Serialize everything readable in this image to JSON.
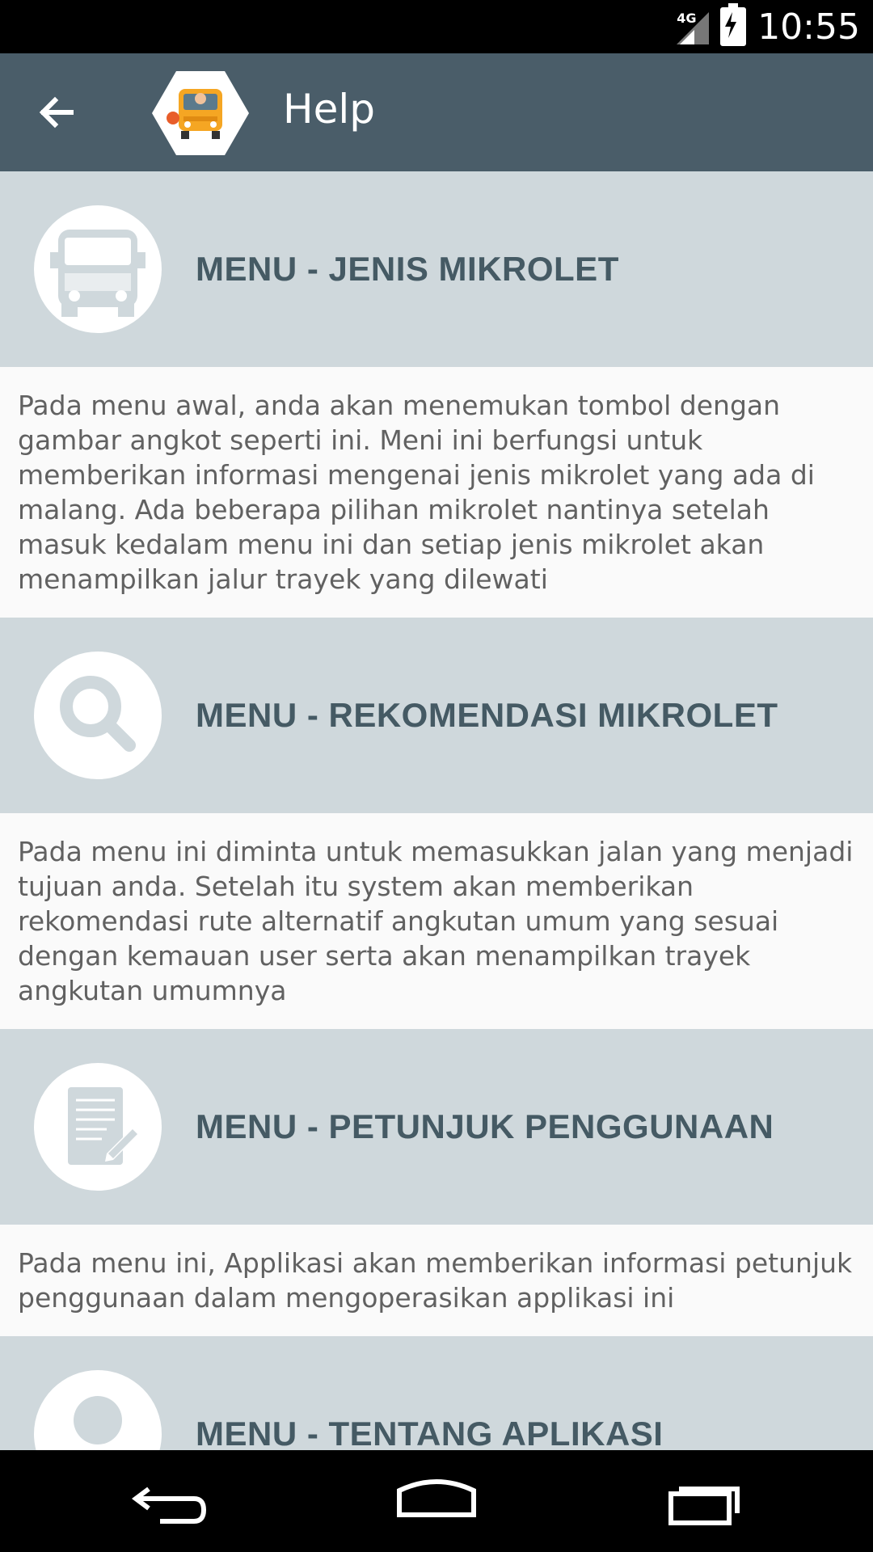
{
  "status_bar": {
    "time": "10:55",
    "network": "4G",
    "icons": [
      "signal-icon",
      "battery-charging-icon"
    ]
  },
  "app_bar": {
    "title": "Help",
    "back_icon": "arrow-back-icon",
    "logo": "bus-logo"
  },
  "sections": [
    {
      "icon": "bus-icon",
      "title": "MENU - JENIS MIKROLET",
      "body": "Pada menu awal, anda akan menemukan tombol dengan gambar angkot seperti ini. Meni ini berfungsi untuk memberikan informasi mengenai jenis mikrolet yang ada di malang. Ada beberapa pilihan mikrolet nantinya setelah masuk kedalam menu ini dan setiap jenis mikrolet akan menampilkan jalur trayek yang dilewati"
    },
    {
      "icon": "search-icon",
      "title": "MENU - REKOMENDASI MIKROLET",
      "body": "Pada menu ini diminta untuk memasukkan jalan yang menjadi tujuan anda. Setelah itu system akan memberikan rekomendasi rute alternatif angkutan umum yang sesuai dengan kemauan user serta akan menampilkan trayek angkutan umumnya"
    },
    {
      "icon": "document-edit-icon",
      "title": "MENU - PETUNJUK PENGGUNAAN",
      "body": "Pada menu ini, Applikasi akan memberikan informasi petunjuk penggunaan dalam mengoperasikan applikasi ini"
    },
    {
      "icon": "person-icon",
      "title": "MENU - TENTANG APLIKASI",
      "body": ""
    }
  ],
  "nav_bar": {
    "back": "back-nav-icon",
    "home": "home-nav-icon",
    "recents": "recents-nav-icon"
  },
  "colors": {
    "appbar": "#4a5d69",
    "header_bg": "#cfd8dc",
    "title": "#455a64",
    "body_text": "#616161",
    "icon_fill": "#cfd8dc"
  }
}
